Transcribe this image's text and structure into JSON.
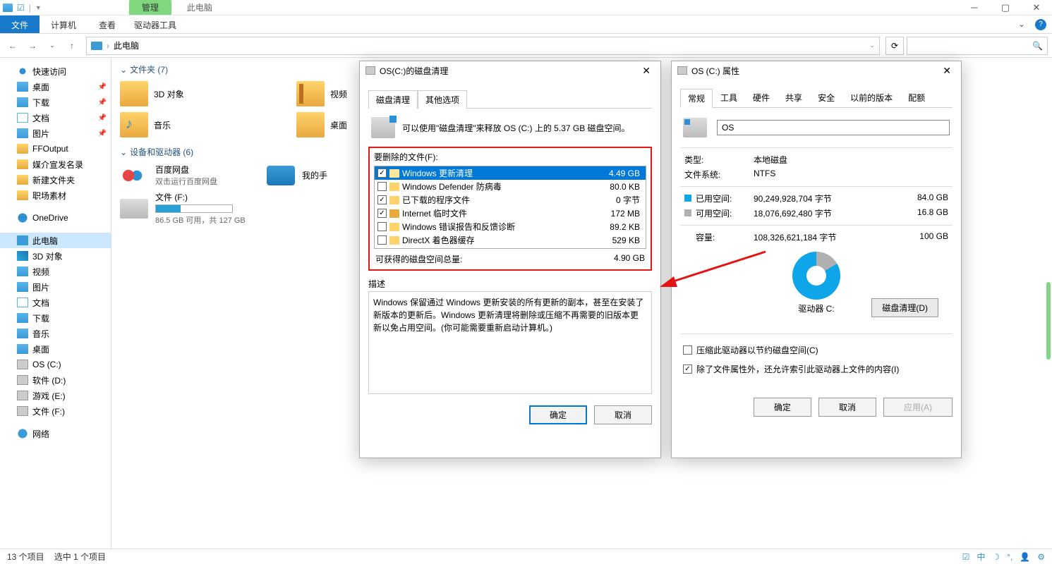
{
  "titlebar": {
    "context_tab": "管理",
    "title": "此电脑"
  },
  "ribbon": {
    "file": "文件",
    "tabs": [
      "计算机",
      "查看"
    ],
    "context": "驱动器工具"
  },
  "nav": {
    "path": "此电脑"
  },
  "sidebar": {
    "quick": {
      "label": "快速访问",
      "items": [
        "桌面",
        "下载",
        "文档",
        "图片",
        "FFOutput",
        "媒介宣发名录",
        "新建文件夹",
        "职场素材"
      ]
    },
    "onedrive": "OneDrive",
    "thispc": {
      "label": "此电脑",
      "items": [
        "3D 对象",
        "视频",
        "图片",
        "文档",
        "下载",
        "音乐",
        "桌面",
        "OS (C:)",
        "软件 (D:)",
        "游戏 (E:)",
        "文件 (F:)"
      ]
    },
    "network": "网络"
  },
  "content": {
    "folders_hdr": "文件夹 (7)",
    "folders": [
      "3D 对象",
      "视频",
      "音乐",
      "桌面"
    ],
    "devices_hdr": "设备和驱动器 (6)",
    "devices": [
      {
        "name": "百度网盘",
        "sub": "双击运行百度网盘"
      },
      {
        "name": "我的手"
      },
      {
        "name": "文件 (F:)",
        "sub": "86.5 GB 可用，共 127 GB"
      }
    ]
  },
  "dc": {
    "title": "OS(C:)的磁盘清理",
    "tabs": [
      "磁盘清理",
      "其他选项"
    ],
    "info": "可以使用\"磁盘清理\"来释放 OS (C:) 上的 5.37 GB 磁盘空间。",
    "list_hdr": "要删除的文件(F):",
    "items": [
      {
        "name": "Windows 更新清理",
        "size": "4.49 GB",
        "checked": true,
        "selected": true
      },
      {
        "name": "Windows Defender 防病毒",
        "size": "80.0 KB",
        "checked": false
      },
      {
        "name": "已下载的程序文件",
        "size": "0 字节",
        "checked": true
      },
      {
        "name": "Internet 临时文件",
        "size": "172 MB",
        "checked": true,
        "lock": true
      },
      {
        "name": "Windows 错误报告和反馈诊断",
        "size": "89.2 KB",
        "checked": false
      },
      {
        "name": "DirectX 着色器缓存",
        "size": "529 KB",
        "checked": false
      }
    ],
    "total_label": "可获得的磁盘空间总量:",
    "total_value": "4.90 GB",
    "desc_hdr": "描述",
    "desc": "Windows 保留通过 Windows 更新安装的所有更新的副本，甚至在安装了新版本的更新后。Windows 更新清理将删除或压缩不再需要的旧版本更新以免占用空间。(你可能需要重新启动计算机。)",
    "ok": "确定",
    "cancel": "取消"
  },
  "prop": {
    "title": "OS (C:) 属性",
    "tabs": [
      "常规",
      "工具",
      "硬件",
      "共享",
      "安全",
      "以前的版本",
      "配额"
    ],
    "name": "OS",
    "type_k": "类型:",
    "type_v": "本地磁盘",
    "fs_k": "文件系统:",
    "fs_v": "NTFS",
    "used_k": "已用空间:",
    "used_b": "90,249,928,704 字节",
    "used_g": "84.0 GB",
    "free_k": "可用空间:",
    "free_b": "18,076,692,480 字节",
    "free_g": "16.8 GB",
    "cap_k": "容量:",
    "cap_b": "108,326,621,184 字节",
    "cap_g": "100 GB",
    "drive_label": "驱动器 C:",
    "cleanup_btn": "磁盘清理(D)",
    "compress": "压缩此驱动器以节约磁盘空间(C)",
    "index": "除了文件属性外，还允许索引此驱动器上文件的内容(I)",
    "ok": "确定",
    "cancel": "取消",
    "apply": "应用(A)"
  },
  "status": {
    "items": "13 个项目",
    "selected": "选中 1 个项目"
  }
}
